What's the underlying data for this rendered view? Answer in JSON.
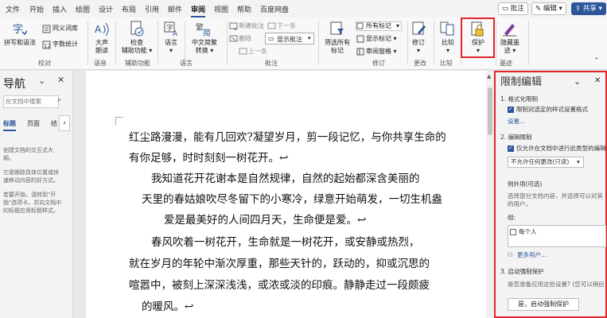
{
  "tabs": [
    "文件",
    "开始",
    "插入",
    "绘图",
    "设计",
    "布局",
    "引用",
    "邮件",
    "审阅",
    "视图",
    "帮助",
    "百度网盘"
  ],
  "active_tab": "审阅",
  "header_buttons": {
    "comment": "批注",
    "edit": "编辑",
    "share": "共享"
  },
  "ribbon": {
    "proofing": {
      "spell": "拼写和语法",
      "thesaurus": "同义词库",
      "wordcount": "字数统计",
      "label": "校对"
    },
    "speech": {
      "read_aloud_1": "大声",
      "read_aloud_2": "朗读",
      "label": "语音"
    },
    "accessibility": {
      "check_1": "检查",
      "check_2": "辅助功能",
      "label": "辅助功能"
    },
    "language": {
      "lang": "语言",
      "label": "语言"
    },
    "chinese": {
      "convert_1": "中文简繁",
      "convert_2": "转换",
      "label": "中文简繁转换"
    },
    "comments": {
      "new": "新建批注",
      "delete": "删除",
      "prev": "上一条",
      "next": "下一条",
      "show": "显示批注",
      "label": "批注"
    },
    "tracking": {
      "markup_1": "筛选所有",
      "markup_2": "标记",
      "all_markup": "所有标记",
      "show_markup": "显示标记",
      "review_pane": "审阅窗格",
      "label": "修订"
    },
    "changes": {
      "track": "修订",
      "label": "更改"
    },
    "compare": {
      "compare": "比较",
      "label": "比较"
    },
    "protect": {
      "protect": "保护"
    },
    "ink": {
      "hide_1": "隐藏墨",
      "hide_2": "迹",
      "label": "墨迹"
    }
  },
  "nav": {
    "title": "导航",
    "search_placeholder": "在文档中搜索",
    "tab_headings": "标题",
    "tab_pages": "页面",
    "tab_results": "结",
    "tip1": [
      "创建文档的交互式大",
      "纲。"
    ],
    "tip2": [
      "它是跟踪具体位置或快",
      "速移动内容的好方式。"
    ],
    "tip3": [
      "若要开始，请转到\"开",
      "始\"选项卡，并向文档中",
      "的标题应用标题样式。"
    ]
  },
  "document": {
    "lines": [
      "红尘路漫漫，能有几回欢?凝望岁月，剪一段记忆，与你共享生命的",
      "有你足够，时时刻刻一树花开。↩",
      "我知道花开花谢本是自然规律，自然的起始都深含美丽的",
      "天里的春姑娘吹尽冬留下的小寒冷，绿意开始萌发，一切生机盎",
      "爱是最美好的人间四月天，生命便是爱。↩",
      "春风吹着一树花开，生命就是一树花开，或安静或热烈，",
      "就在岁月的年轮中渐次厚重，那些天针的，跃动的，抑或沉思的",
      "喧嚣中，被刻上深深浅浅，或浓或淡的印痕。静静走过一段颇疲",
      "的暖风。↩"
    ]
  },
  "restrict_pane": {
    "title": "限制编辑",
    "s1_heading": "1. 格式化限制",
    "s1_checkbox": "限制对选定的样式设置格式",
    "s1_link": "设置...",
    "s2_heading": "2. 编辑限制",
    "s2_checkbox": "仅允许在文档中进行此类型的编辑",
    "s2_dropdown": "不允许任何更改(只读)",
    "exceptions": "例外项(可选)",
    "exceptions_desc_1": "选择部分文档内容，并选择可以对其",
    "exceptions_desc_2": "的用户。",
    "groups": "组:",
    "everyone": "每个人",
    "more_users": "更多用户...",
    "s3_heading": "3. 启动强制保护",
    "s3_desc": "是否准备应用这些设置? (您可以稍后",
    "enforce_button": "是，启动强制保护"
  }
}
